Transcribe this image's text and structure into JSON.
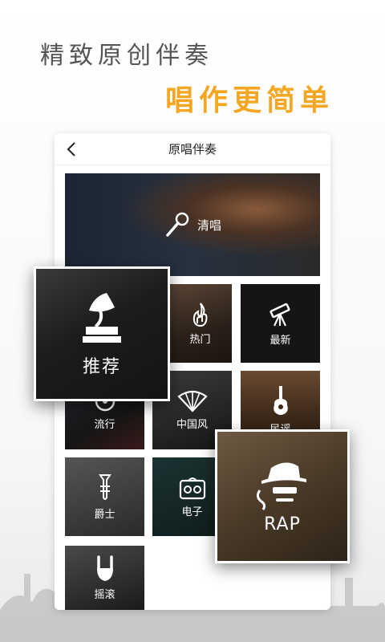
{
  "promo": {
    "line1": "精致原创伴奏",
    "line2": "唱作更简单"
  },
  "header": {
    "title": "原唱伴奏"
  },
  "categories": {
    "banner": "清唱",
    "hot": "热门",
    "newest": "最新",
    "popular": "流行",
    "chinese": "中国风",
    "folk": "民谣",
    "jazz": "爵士",
    "electronic": "电子",
    "rock": "摇滚"
  },
  "highlights": {
    "recommend": "推荐",
    "rap": "RAP"
  },
  "colors": {
    "accent": "#f5a623",
    "text_gray": "#555555"
  }
}
